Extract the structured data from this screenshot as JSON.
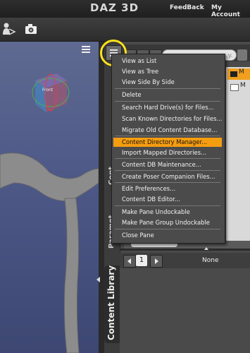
{
  "header": {
    "logo": "DAZ 3D",
    "links": [
      {
        "label": "FeedBack"
      },
      {
        "label": "My Account"
      }
    ]
  },
  "toolbar": {
    "icons": [
      "figure-icon",
      "camera-icon"
    ]
  },
  "viewport": {
    "cube_label": "Front"
  },
  "pane": {
    "side_tabs": [
      "Content Library",
      "Paramet",
      "Cont"
    ],
    "search_placeholder": "...y.",
    "folders": [
      {
        "label": "M",
        "selected": true
      },
      {
        "label": "M",
        "selected": false
      }
    ],
    "pager": {
      "page": "1",
      "filter": "None"
    }
  },
  "menu": {
    "items": [
      {
        "label": "View as List"
      },
      {
        "label": "View as Tree"
      },
      {
        "label": "View Side By Side"
      },
      {
        "label": "Delete"
      },
      {
        "label": "Search Hard Drive(s) for Files..."
      },
      {
        "label": "Scan Known Directories for Files..."
      },
      {
        "label": "Migrate Old Content Database..."
      },
      {
        "label": "Content Directory Manager...",
        "highlighted": true
      },
      {
        "label": "Import Mapped Directories..."
      },
      {
        "label": "Content DB Maintenance..."
      },
      {
        "label": "Create Poser Companion Files..."
      },
      {
        "label": "Edit Preferences..."
      },
      {
        "label": "Content DB Editor..."
      },
      {
        "label": "Make Pane Undockable"
      },
      {
        "label": "Make Pane Group Undockable"
      },
      {
        "label": "Close Pane"
      }
    ]
  },
  "colors": {
    "highlight": "#f59d10",
    "annotation_ring": "#ffe21a",
    "viewport_blue": "#4d5887"
  }
}
